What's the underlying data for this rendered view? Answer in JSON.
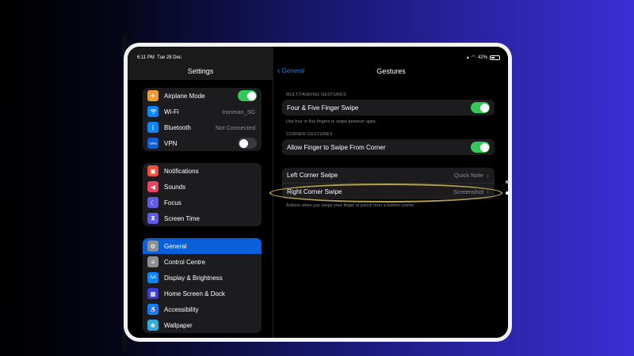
{
  "status": {
    "time": "6:11 PM",
    "date": "Tue 28 Dec",
    "battery": "42%"
  },
  "sidebar": {
    "title": "Settings",
    "group1": [
      {
        "label": "Airplane Mode",
        "icon": "airplane-icon",
        "color": "#f09a37",
        "toggle": "on"
      },
      {
        "label": "Wi-Fi",
        "icon": "wifi-icon",
        "color": "#0a84ff",
        "value": "Ironman_5G"
      },
      {
        "label": "Bluetooth",
        "icon": "bluetooth-icon",
        "color": "#0a84ff",
        "value": "Not Connected"
      },
      {
        "label": "VPN",
        "icon": "vpn-icon",
        "color": "#0a60d8",
        "toggle": "off",
        "icon_text": "VPN"
      }
    ],
    "group2": [
      {
        "label": "Notifications",
        "icon": "notifications-icon",
        "color": "#eb4d3d"
      },
      {
        "label": "Sounds",
        "icon": "sounds-icon",
        "color": "#eb445a"
      },
      {
        "label": "Focus",
        "icon": "focus-moon-icon",
        "color": "#5e5ce6"
      },
      {
        "label": "Screen Time",
        "icon": "hourglass-icon",
        "color": "#5e5ce6"
      }
    ],
    "group3": [
      {
        "label": "General",
        "icon": "gear-icon",
        "color": "#8e8e93",
        "selected": true
      },
      {
        "label": "Control Centre",
        "icon": "control-centre-icon",
        "color": "#8e8e93"
      },
      {
        "label": "Display & Brightness",
        "icon": "display-icon",
        "color": "#0a84ff",
        "icon_text": "AA"
      },
      {
        "label": "Home Screen & Dock",
        "icon": "home-screen-icon",
        "color": "#3a3adf"
      },
      {
        "label": "Accessibility",
        "icon": "accessibility-icon",
        "color": "#0a84ff"
      },
      {
        "label": "Wallpaper",
        "icon": "wallpaper-icon",
        "color": "#34aadc"
      }
    ]
  },
  "detail": {
    "back_label": "General",
    "title": "Gestures",
    "multitasking_header": "MULTITASKING GESTURES",
    "four_five_label": "Four & Five Finger Swipe",
    "four_five_toggle": "on",
    "four_five_note": "Use four or five fingers to swipe between apps.",
    "corner_header": "CORNER GESTURES",
    "allow_finger_label": "Allow Finger to Swipe From Corner",
    "allow_finger_toggle": "on",
    "left_corner_label": "Left Corner Swipe",
    "left_corner_value": "Quick Note",
    "right_corner_label": "Right Corner Swipe",
    "right_corner_value": "Screenshot",
    "corner_note": "Actions when you swipe your finger or pencil from a bottom corner."
  },
  "highlight_color": "#b8a24a"
}
